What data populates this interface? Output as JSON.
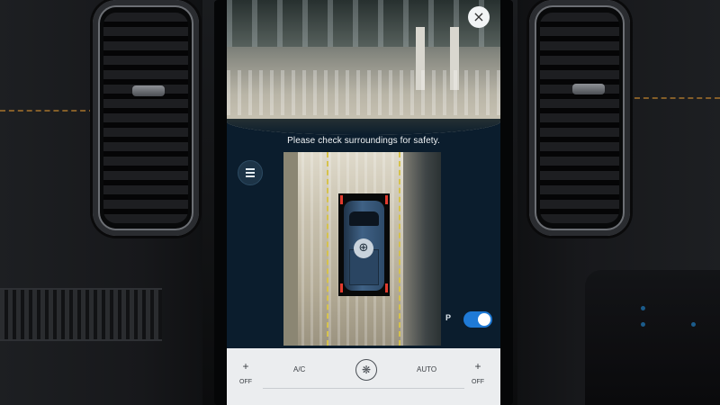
{
  "screen": {
    "message": "Please check surroundings for safety.",
    "close_icon": "close-icon",
    "menu_icon": "hamburger-menu-icon",
    "zoom_icon": "zoom-in-icon",
    "parking_toggle": {
      "icon_label": "P",
      "state": "on",
      "color": "#1f7ad6"
    }
  },
  "climate": {
    "left_plus": "+",
    "left_off": "OFF",
    "ac_label": "A/C",
    "fan_icon": "fan-icon",
    "auto_label": "AUTO",
    "right_plus": "+",
    "right_off": "OFF"
  },
  "colors": {
    "accent": "#1f7ad6",
    "stitching": "#a8742c",
    "screen_bg": "#0b1d2d"
  }
}
